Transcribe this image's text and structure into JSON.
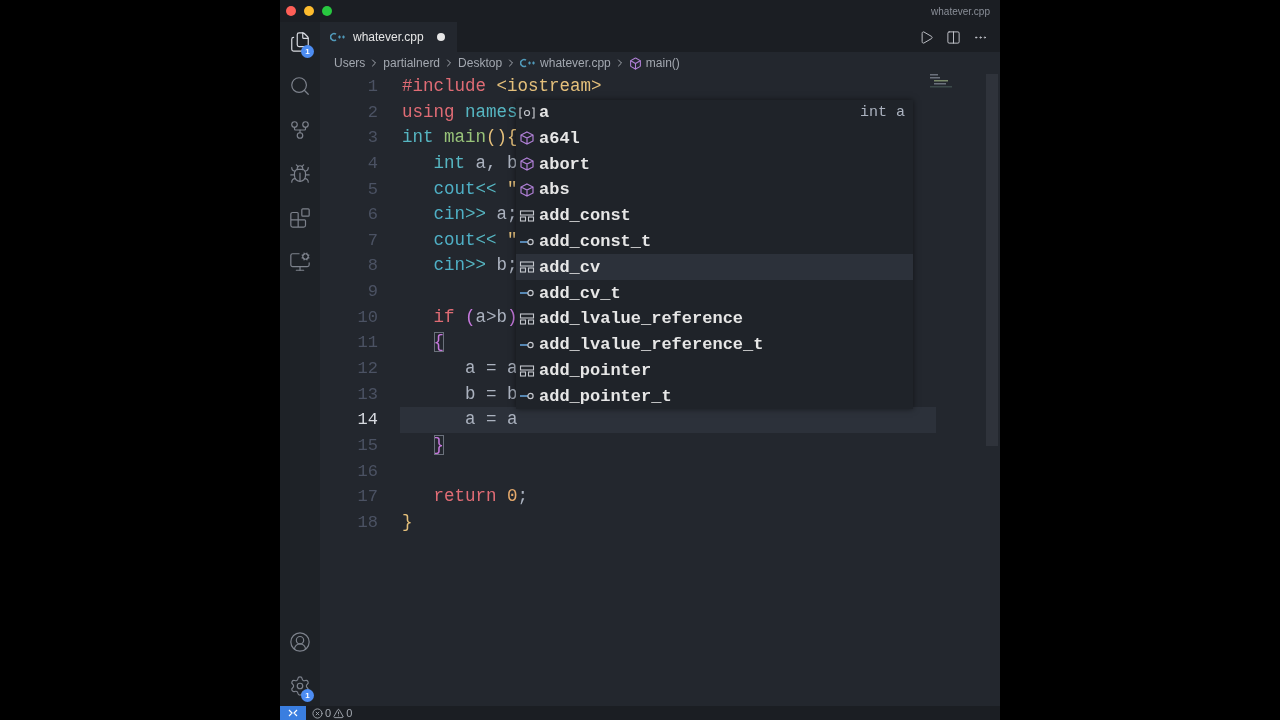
{
  "window": {
    "title": "whatever.cpp"
  },
  "activity_bar": {
    "items": [
      {
        "kind": "files",
        "selected": true,
        "badge": "1"
      },
      {
        "kind": "search",
        "selected": false
      },
      {
        "kind": "source-control",
        "selected": false
      },
      {
        "kind": "run-debug",
        "selected": false
      },
      {
        "kind": "extensions",
        "selected": false
      },
      {
        "kind": "remote",
        "selected": false
      }
    ],
    "bottom_items": [
      {
        "kind": "account"
      },
      {
        "kind": "settings",
        "badge": "1"
      }
    ]
  },
  "tabs": [
    {
      "label": "whatever.cpp",
      "selected": true,
      "modified": true
    }
  ],
  "breadcrumbs": [
    {
      "label": "Users"
    },
    {
      "label": "partialnerd"
    },
    {
      "label": "Desktop"
    },
    {
      "label": "whatever.cpp",
      "kind": "file"
    },
    {
      "label": "main()",
      "kind": "function"
    }
  ],
  "code": [
    {
      "number": "1",
      "current": false,
      "tokens": [
        {
          "kind": "keyword",
          "text": "#include"
        },
        {
          "kind": "string",
          "text": " <iostream>"
        }
      ]
    },
    {
      "number": "2",
      "current": false,
      "tokens": [
        {
          "kind": "keyword",
          "text": "using"
        },
        {
          "kind": "type",
          "text": " names"
        }
      ]
    },
    {
      "number": "3",
      "current": false,
      "tokens": [
        {
          "kind": "type",
          "text": "int"
        },
        {
          "kind": "function",
          "text": " main"
        },
        {
          "kind": "bracket",
          "text": "(){"
        }
      ]
    },
    {
      "number": "4",
      "current": false,
      "tokens": [
        {
          "kind": "type",
          "text": "   int"
        },
        {
          "kind": "plain",
          "text": " a, b"
        }
      ]
    },
    {
      "number": "5",
      "current": false,
      "tokens": [
        {
          "kind": "ident",
          "text": "   cout"
        },
        {
          "kind": "type",
          "text": "<<"
        },
        {
          "kind": "string",
          "text": " \""
        }
      ]
    },
    {
      "number": "6",
      "current": false,
      "tokens": [
        {
          "kind": "ident",
          "text": "   cin"
        },
        {
          "kind": "type",
          "text": ">>"
        },
        {
          "kind": "plain",
          "text": " a;"
        }
      ]
    },
    {
      "number": "7",
      "current": false,
      "tokens": [
        {
          "kind": "ident",
          "text": "   cout"
        },
        {
          "kind": "type",
          "text": "<<"
        },
        {
          "kind": "string",
          "text": " \""
        }
      ]
    },
    {
      "number": "8",
      "current": false,
      "tokens": [
        {
          "kind": "ident",
          "text": "   cin"
        },
        {
          "kind": "type",
          "text": ">>"
        },
        {
          "kind": "plain",
          "text": " b;"
        }
      ]
    },
    {
      "number": "9",
      "current": false
    },
    {
      "number": "10",
      "current": false,
      "tokens": [
        {
          "kind": "keyword",
          "text": "   if"
        },
        {
          "kind": "bracket2",
          "text": " ("
        },
        {
          "kind": "plain",
          "text": "a>b"
        },
        {
          "kind": "bracket2",
          "text": ")"
        }
      ]
    },
    {
      "number": "11",
      "current": false,
      "tokens": [
        {
          "kind": "bracket-match",
          "text": "   {"
        }
      ]
    },
    {
      "number": "12",
      "current": false,
      "tokens": [
        {
          "kind": "plain",
          "text": "      a = a"
        }
      ]
    },
    {
      "number": "13",
      "current": false,
      "tokens": [
        {
          "kind": "plain",
          "text": "      b = b"
        }
      ]
    },
    {
      "number": "14",
      "current": true,
      "tokens": [
        {
          "kind": "plain",
          "text": "      a = a"
        }
      ]
    },
    {
      "number": "15",
      "current": false,
      "tokens": [
        {
          "kind": "bracket-match",
          "text": "   }"
        }
      ]
    },
    {
      "number": "16",
      "current": false
    },
    {
      "number": "17",
      "current": false,
      "tokens": [
        {
          "kind": "keyword",
          "text": "   return"
        },
        {
          "kind": "number",
          "text": " 0"
        },
        {
          "kind": "plain",
          "text": ";"
        }
      ]
    },
    {
      "number": "18",
      "current": false,
      "tokens": [
        {
          "kind": "bracket",
          "text": "}"
        }
      ]
    }
  ],
  "suggestions": [
    {
      "label": "a",
      "kind": "variable",
      "detail": "int a",
      "selected": false
    },
    {
      "label": "a64l",
      "kind": "method",
      "selected": false
    },
    {
      "label": "abort",
      "kind": "method",
      "selected": false
    },
    {
      "label": "abs",
      "kind": "method",
      "selected": false
    },
    {
      "label": "add_const",
      "kind": "struct",
      "selected": false
    },
    {
      "label": "add_const_t",
      "kind": "alias",
      "selected": false
    },
    {
      "label": "add_cv",
      "kind": "struct",
      "selected": true
    },
    {
      "label": "add_cv_t",
      "kind": "alias",
      "selected": false
    },
    {
      "label": "add_lvalue_reference",
      "kind": "struct",
      "selected": false
    },
    {
      "label": "add_lvalue_reference_t",
      "kind": "alias",
      "selected": false
    },
    {
      "label": "add_pointer",
      "kind": "struct",
      "selected": false
    },
    {
      "label": "add_pointer_t",
      "kind": "alias",
      "selected": false
    }
  ],
  "status_bar": {
    "errors": "0",
    "warnings": "0"
  }
}
